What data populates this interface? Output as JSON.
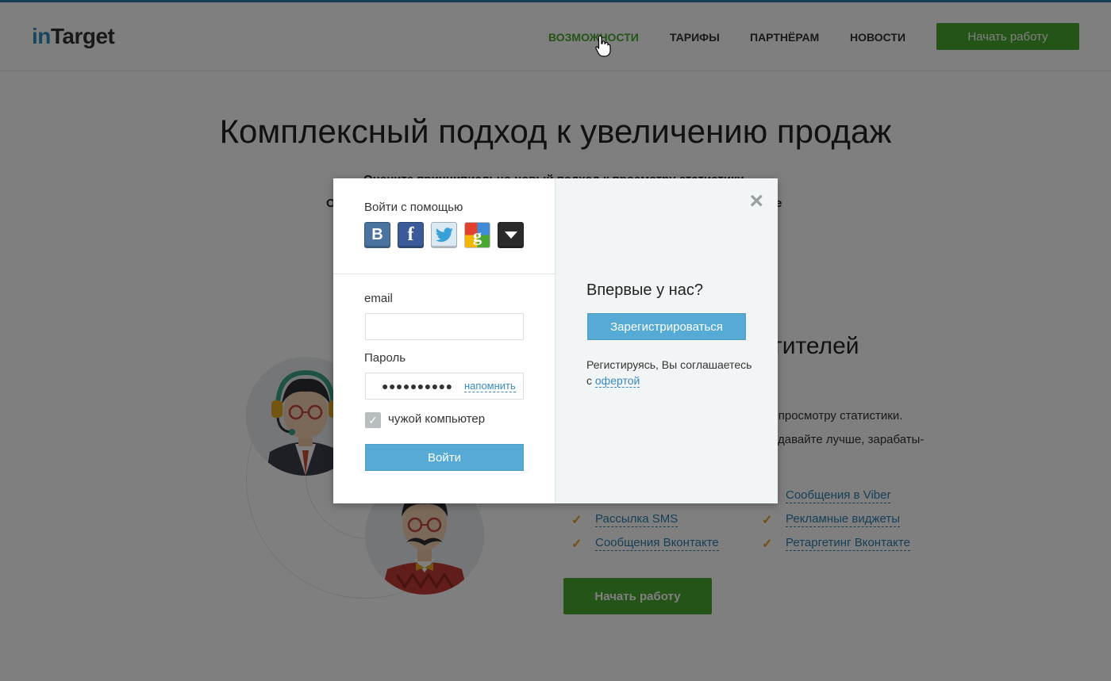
{
  "header": {
    "logo_in": "in",
    "logo_target": "Target",
    "nav": [
      "ВОЗМОЖНОСТИ",
      "ТАРИФЫ",
      "ПАРТНЁРАМ",
      "НОВОСТИ"
    ],
    "cta": "Начать работу"
  },
  "hero": {
    "title": "Комплексный подход к увеличению продаж",
    "subtitle_line1": "Оцените принципиально новый подход к просмотру статистики.",
    "subtitle_line2_start": "О",
    "subtitle_line2_end": "е"
  },
  "section": {
    "title_fragment": "тителей",
    "p1_fragment": "к просмотру статистики.",
    "p2_fragment": "давайте лучше, зарабаты-",
    "features_left": [
      "Рассылка SMS",
      "Сообщения Вконтакте"
    ],
    "features_right": [
      "Сообщения в Viber",
      "Рекламные виджеты",
      "Ретаргетинг Вконтакте"
    ],
    "cta": "Начать работу"
  },
  "modal": {
    "login_with": "Войти с помощью",
    "social_icons": [
      "vk-icon",
      "facebook-icon",
      "twitter-icon",
      "google-icon",
      "more-icon"
    ],
    "email_label": "email",
    "email_value": "",
    "password_label": "Пароль",
    "password_masked": "●●●●●●●●●●",
    "remind": "напомнить",
    "foreign_computer": "чужой компьютер",
    "foreign_computer_checked": true,
    "login_button": "Войти",
    "close": "×",
    "first_time": "Впервые у нас?",
    "register_button": "Зарегистрироваться",
    "terms_text": "Регистируясь, Вы соглашаетесь с",
    "terms_link": "офертой"
  },
  "colors": {
    "accent_green": "#4aa832",
    "accent_blue": "#55abd6",
    "link_blue": "#3a8ac0"
  }
}
